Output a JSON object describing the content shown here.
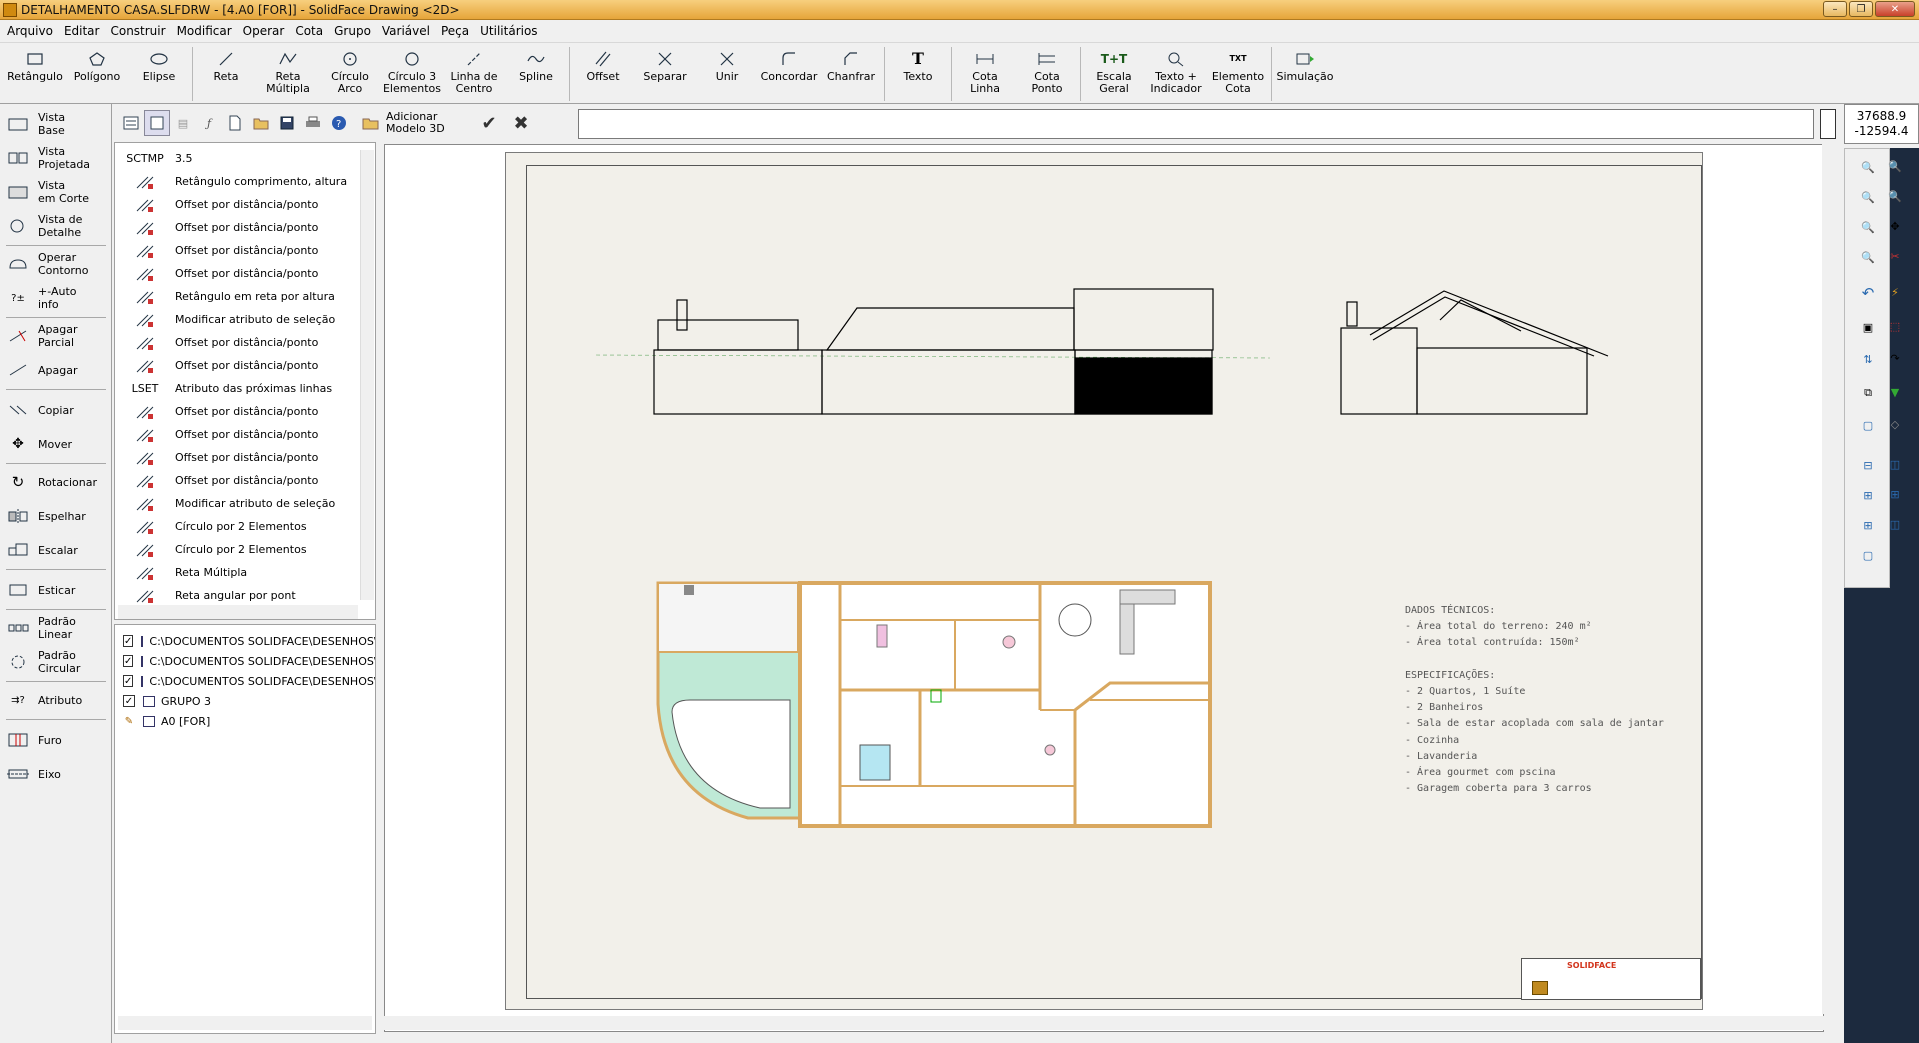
{
  "window": {
    "title": "DETALHAMENTO CASA.SLFDRW - [4.A0 [FOR]] - SolidFace Drawing <2D>"
  },
  "menu": [
    "Arquivo",
    "Editar",
    "Construir",
    "Modificar",
    "Operar",
    "Cota",
    "Grupo",
    "Variável",
    "Peça",
    "Utilitários"
  ],
  "toolbar": {
    "retangulo": "Retângulo",
    "poligono": "Polígono",
    "elipse": "Elipse",
    "reta": "Reta",
    "reta_multipla_1": "Reta",
    "reta_multipla_2": "Múltipla",
    "circulo_arco_1": "Círculo",
    "circulo_arco_2": "Arco",
    "circulo3_1": "Círculo 3",
    "circulo3_2": "Elementos",
    "linha_centro_1": "Linha de",
    "linha_centro_2": "Centro",
    "spline": "Spline",
    "offset": "Offset",
    "separar": "Separar",
    "unir": "Unir",
    "concordar": "Concordar",
    "chanfrar": "Chanfrar",
    "texto": "Texto",
    "cota_linha_1": "Cota",
    "cota_linha_2": "Linha",
    "cota_ponto_1": "Cota",
    "cota_ponto_2": "Ponto",
    "escala_1": "Escala",
    "escala_2": "Geral",
    "texto_ind_1": "Texto +",
    "texto_ind_2": "Indicador",
    "elem_cota_1": "Elemento",
    "elem_cota_2": "Cota",
    "simulacao": "Simulação"
  },
  "coords": {
    "x": "37688.9",
    "y": "-12594.4"
  },
  "left_tools": {
    "vista_base_1": "Vista",
    "vista_base_2": "Base",
    "vista_proj_1": "Vista",
    "vista_proj_2": "Projetada",
    "vista_corte_1": "Vista",
    "vista_corte_2": "em Corte",
    "vista_det_1": "Vista de",
    "vista_det_2": "Detalhe",
    "operar_1": "Operar",
    "operar_2": "Contorno",
    "auto_1": "+-Auto",
    "auto_2": "info",
    "apagar_parcial_1": "Apagar",
    "apagar_parcial_2": "Parcial",
    "apagar": "Apagar",
    "copiar": "Copiar",
    "mover": "Mover",
    "rotacionar": "Rotacionar",
    "espelhar": "Espelhar",
    "escalar": "Escalar",
    "esticar": "Esticar",
    "padrao_lin_1": "Padrão",
    "padrao_lin_2": "Linear",
    "padrao_circ_1": "Padrão",
    "padrao_circ_2": "Circular",
    "atributo": "Atributo",
    "furo": "Furo",
    "eixo": "Eixo"
  },
  "subtoolbar": {
    "adicionar_1": "Adicionar",
    "adicionar_2": "Modelo 3D"
  },
  "history": [
    {
      "label": "SCTMP",
      "text": "3.5"
    },
    {
      "label": "",
      "text": "Retângulo comprimento, altura"
    },
    {
      "label": "",
      "text": "Offset por distância/ponto"
    },
    {
      "label": "",
      "text": "Offset por distância/ponto"
    },
    {
      "label": "",
      "text": "Offset por distância/ponto"
    },
    {
      "label": "",
      "text": "Offset por distância/ponto"
    },
    {
      "label": "",
      "text": "Retângulo em reta por altura"
    },
    {
      "label": "",
      "text": "Modificar atributo de seleção"
    },
    {
      "label": "",
      "text": "Offset por distância/ponto"
    },
    {
      "label": "",
      "text": "Offset por distância/ponto"
    },
    {
      "label": "LSET",
      "text": "Atributo das próximas linhas"
    },
    {
      "label": "",
      "text": "Offset por distância/ponto"
    },
    {
      "label": "",
      "text": "Offset por distância/ponto"
    },
    {
      "label": "",
      "text": "Offset por distância/ponto"
    },
    {
      "label": "",
      "text": "Offset por distância/ponto"
    },
    {
      "label": "",
      "text": "Modificar atributo de seleção"
    },
    {
      "label": "",
      "text": "Círculo por 2 Elementos"
    },
    {
      "label": "",
      "text": "Círculo por 2 Elementos"
    },
    {
      "label": "",
      "text": "Reta Múltipla"
    },
    {
      "label": "",
      "text": "Reta angular por pont"
    }
  ],
  "tree": [
    "C:\\DOCUMENTOS SOLIDFACE\\DESENHOS\\DI",
    "C:\\DOCUMENTOS SOLIDFACE\\DESENHOS\\DI",
    "C:\\DOCUMENTOS SOLIDFACE\\DESENHOS\\DI",
    "GRUPO 3",
    "A0 [FOR]"
  ],
  "drawing": {
    "specs": "DADOS TÉCNICOS:\n- Área total do terreno: 240 m²\n- Área total contruída: 150m²\n\nESPECIFICAÇÕES:\n- 2 Quartos, 1 Suíte\n- 2 Banheiros\n- Sala de estar acoplada com sala de jantar\n- Cozinha\n- Lavanderia\n- Área gourmet com pscina\n- Garagem coberta para 3 carros",
    "titleblock_brand": "SOLIDFACE"
  }
}
